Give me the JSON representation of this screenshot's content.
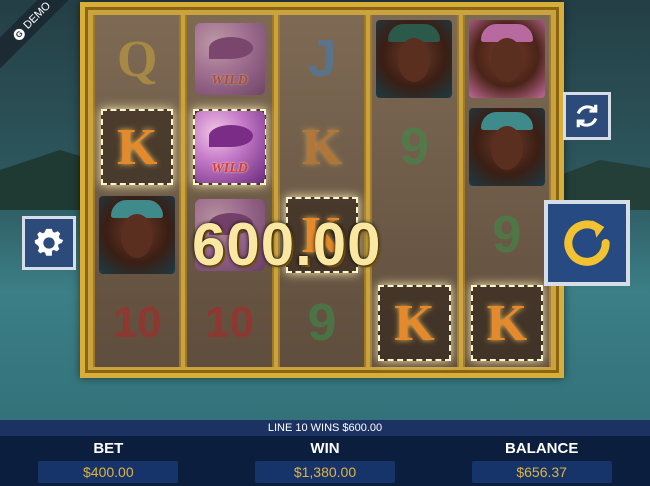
{
  "demo_badge": "DEMO",
  "big_win_amount": "600.00",
  "message": "LINE 10 WINS $600.00",
  "stats": {
    "bet_label": "BET",
    "bet_value": "$400.00",
    "win_label": "WIN",
    "win_value": "$1,380.00",
    "balance_label": "BALANCE",
    "balance_value": "$656.37"
  },
  "reels": [
    [
      "Q",
      "K",
      "portrait-woman",
      "10"
    ],
    [
      "toucan-wild",
      "toucan-wild",
      "toucan",
      "10"
    ],
    [
      "J",
      "K",
      "K",
      "9"
    ],
    [
      "portrait-man",
      "9",
      "",
      "K"
    ],
    [
      "portrait-woman",
      "portrait-woman",
      "9",
      "K"
    ]
  ],
  "wild_text": "WILD",
  "symbols": {
    "Q": "Q",
    "K": "K",
    "J": "J",
    "n9": "9",
    "n10": "10"
  },
  "icons": {
    "settings": "gear-icon",
    "autoplay": "refresh-icon",
    "spin": "spin-arrow-icon"
  },
  "colors": {
    "gold": "#d8ad3a",
    "button": "#2c4a7a",
    "win_value": "#e0b33c"
  }
}
